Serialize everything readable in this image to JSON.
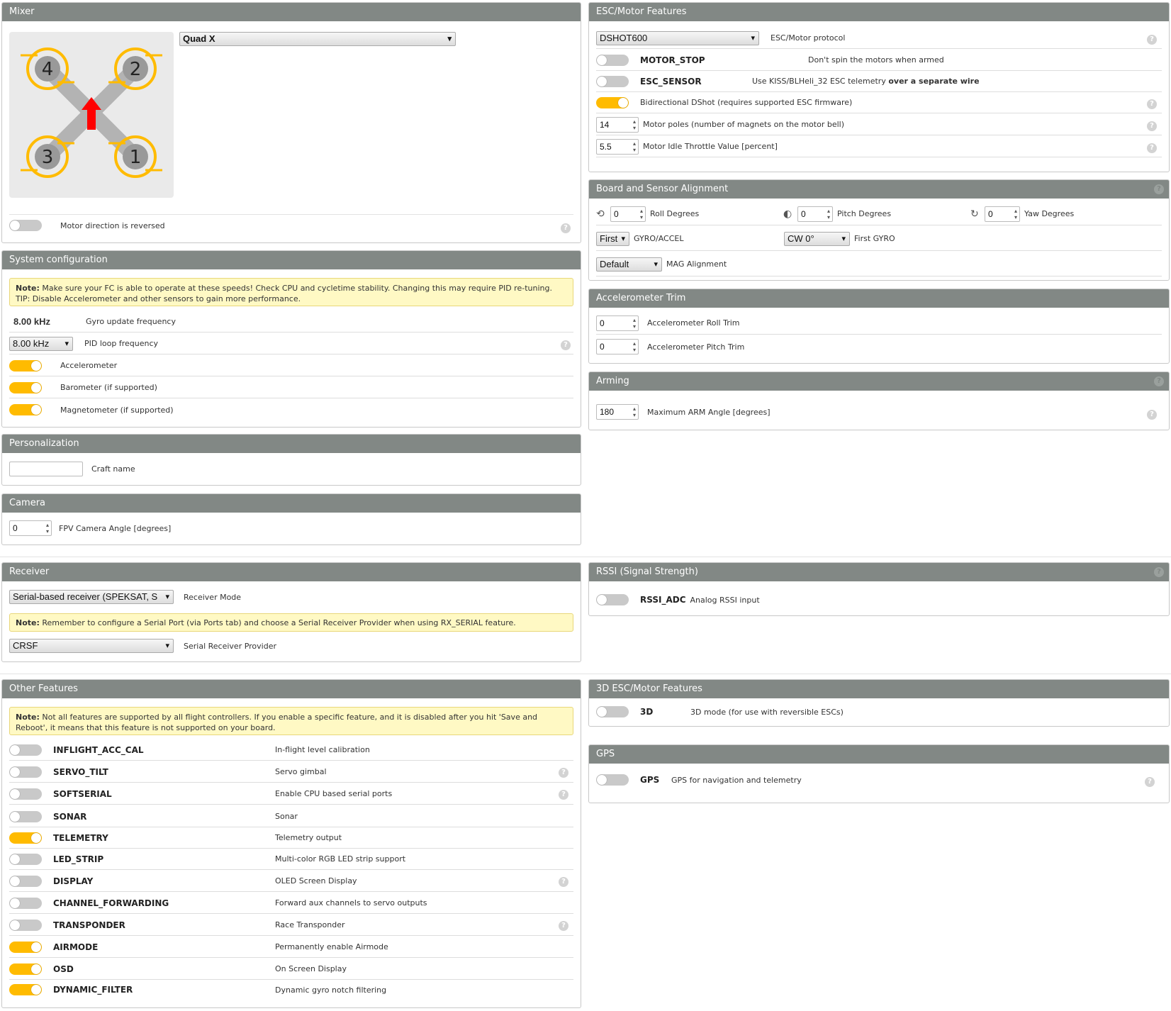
{
  "mixer": {
    "title": "Mixer",
    "type": "Quad X",
    "motors": [
      "1",
      "2",
      "3",
      "4"
    ],
    "reversed_label": "Motor direction is reversed",
    "reversed": false
  },
  "system": {
    "title": "System configuration",
    "note_bold": "Note:",
    "note": " Make sure your FC is able to operate at these speeds! Check CPU and cycletime stability. Changing this may require PID re-tuning. TIP: Disable Accelerometer and other sensors to gain more performance.",
    "gyro_value": "8.00 kHz",
    "gyro_label": "Gyro update frequency",
    "pid_value": "8.00 kHz",
    "pid_label": "PID loop frequency",
    "accel_label": "Accelerometer",
    "accel": true,
    "baro_label": "Barometer (if supported)",
    "baro": true,
    "mag_label": "Magnetometer (if supported)",
    "mag": true
  },
  "personalization": {
    "title": "Personalization",
    "craft_label": "Craft name",
    "craft_value": ""
  },
  "camera": {
    "title": "Camera",
    "angle_value": "0",
    "angle_label": "FPV Camera Angle [degrees]"
  },
  "receiver": {
    "title": "Receiver",
    "mode_value": "Serial-based receiver (SPEKSAT, S",
    "mode_label": "Receiver Mode",
    "note_bold": "Note:",
    "note": " Remember to configure a Serial Port (via Ports tab) and choose a Serial Receiver Provider when using RX_SERIAL feature.",
    "provider_value": "CRSF",
    "provider_label": "Serial Receiver Provider"
  },
  "other": {
    "title": "Other Features",
    "note_bold": "Note:",
    "note": " Not all features are supported by all flight controllers. If you enable a specific feature, and it is disabled after you hit 'Save and Reboot', it means that this feature is not supported on your board.",
    "features": [
      {
        "name": "INFLIGHT_ACC_CAL",
        "desc": "In-flight level calibration",
        "on": false,
        "help": false
      },
      {
        "name": "SERVO_TILT",
        "desc": "Servo gimbal",
        "on": false,
        "help": true
      },
      {
        "name": "SOFTSERIAL",
        "desc": "Enable CPU based serial ports",
        "on": false,
        "help": true
      },
      {
        "name": "SONAR",
        "desc": "Sonar",
        "on": false,
        "help": false
      },
      {
        "name": "TELEMETRY",
        "desc": "Telemetry output",
        "on": true,
        "help": false
      },
      {
        "name": "LED_STRIP",
        "desc": "Multi-color RGB LED strip support",
        "on": false,
        "help": false
      },
      {
        "name": "DISPLAY",
        "desc": "OLED Screen Display",
        "on": false,
        "help": true
      },
      {
        "name": "CHANNEL_FORWARDING",
        "desc": "Forward aux channels to servo outputs",
        "on": false,
        "help": false
      },
      {
        "name": "TRANSPONDER",
        "desc": "Race Transponder",
        "on": false,
        "help": true
      },
      {
        "name": "AIRMODE",
        "desc": "Permanently enable Airmode",
        "on": true,
        "help": false
      },
      {
        "name": "OSD",
        "desc": "On Screen Display",
        "on": true,
        "help": false
      },
      {
        "name": "DYNAMIC_FILTER",
        "desc": "Dynamic gyro notch filtering",
        "on": true,
        "help": false
      }
    ]
  },
  "esc": {
    "title": "ESC/Motor Features",
    "protocol_value": "DSHOT600",
    "protocol_label": "ESC/Motor protocol",
    "motor_stop_name": "MOTOR_STOP",
    "motor_stop_desc": "Don't spin the motors when armed",
    "motor_stop": false,
    "esc_sensor_name": "ESC_SENSOR",
    "esc_sensor_desc": "Use KISS/BLHeli_32 ESC telemetry ",
    "esc_sensor_desc_bold": "over a separate wire",
    "esc_sensor": false,
    "bidir_label": "Bidirectional DShot (requires supported ESC firmware)",
    "bidir": true,
    "poles_value": "14",
    "poles_label": "Motor poles (number of magnets on the motor bell)",
    "idle_value": "5.5",
    "idle_label": "Motor Idle Throttle Value [percent]"
  },
  "alignment": {
    "title": "Board and Sensor Alignment",
    "roll_value": "0",
    "roll_label": "Roll Degrees",
    "pitch_value": "0",
    "pitch_label": "Pitch Degrees",
    "yaw_value": "0",
    "yaw_label": "Yaw Degrees",
    "gyro_sel": "First",
    "gyro_label": "GYRO/ACCEL",
    "gyro_align": "CW 0°",
    "gyro_align_label": "First GYRO",
    "mag_value": "Default",
    "mag_label": "MAG Alignment"
  },
  "acc_trim": {
    "title": "Accelerometer Trim",
    "roll_value": "0",
    "roll_label": "Accelerometer Roll Trim",
    "pitch_value": "0",
    "pitch_label": "Accelerometer Pitch Trim"
  },
  "arming": {
    "title": "Arming",
    "angle_value": "180",
    "angle_label": "Maximum ARM Angle [degrees]"
  },
  "rssi": {
    "title": "RSSI (Signal Strength)",
    "name": "RSSI_ADC",
    "desc": "Analog RSSI input",
    "on": false
  },
  "esc3d": {
    "title": "3D ESC/Motor Features",
    "name": "3D",
    "desc": "3D mode (for use with reversible ESCs)",
    "on": false
  },
  "gps": {
    "title": "GPS",
    "name": "GPS",
    "desc": "GPS for navigation and telemetry",
    "on": false
  },
  "help_glyph": "?",
  "colors": {
    "header": "#828885",
    "toggle_on": "#ffbb00",
    "toggle_off": "#c9c9c9",
    "note_bg": "#fff9c4",
    "motor_ring": "#ffbb00",
    "arrow": "#ff0000"
  }
}
